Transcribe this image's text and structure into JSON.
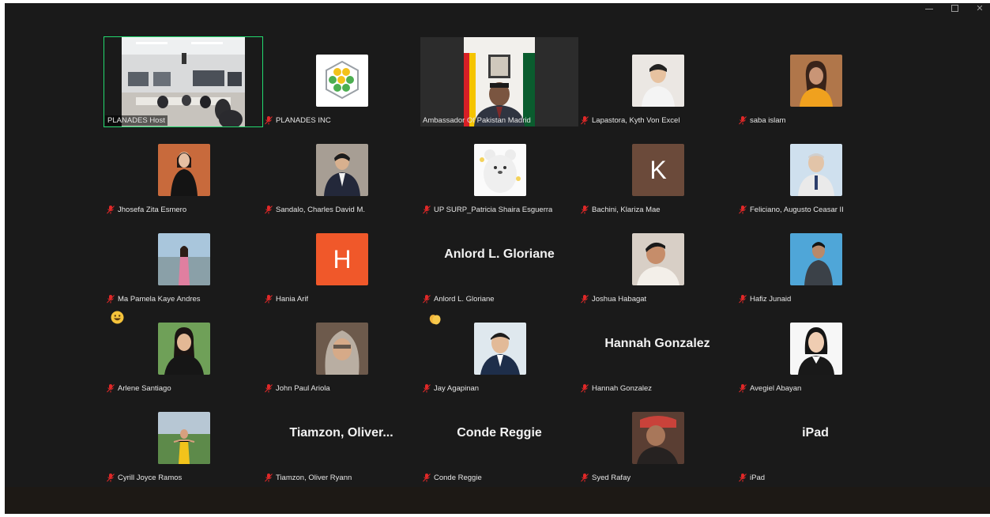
{
  "window": {
    "controls": [
      "minimize",
      "restore",
      "close"
    ]
  },
  "colors": {
    "active_speaker_border": "#23d96f",
    "muted_mic": "#e02828",
    "background": "#1a1a1a"
  },
  "participants": [
    {
      "name": "PLANADES Host",
      "muted": false,
      "video": "classroom",
      "active": true
    },
    {
      "name": "PLANADES INC",
      "muted": true,
      "avatar": "honeycomb-logo"
    },
    {
      "name": "Ambassador Of Pakistan Madrid",
      "muted": false,
      "video": "office-flags"
    },
    {
      "name": "Lapastora, Kyth Von Excel",
      "muted": true,
      "avatar": "photo"
    },
    {
      "name": "saba islam",
      "muted": true,
      "avatar": "photo"
    },
    {
      "name": "Jhosefa Zita Esmero",
      "muted": true,
      "avatar": "photo"
    },
    {
      "name": "Sandalo, Charles David M.",
      "muted": true,
      "avatar": "photo"
    },
    {
      "name": "UP SURP_Patricia Shaira Esguerra",
      "muted": true,
      "avatar": "bear"
    },
    {
      "name": "Bachini, Klariza Mae",
      "muted": true,
      "avatar_letter": "K",
      "avatar_color": "#6b4a3a"
    },
    {
      "name": "Feliciano, Augusto Ceasar II",
      "muted": true,
      "avatar": "photo"
    },
    {
      "name": "Ma Pamela Kaye Andres",
      "muted": true,
      "avatar": "photo"
    },
    {
      "name": "Hania Arif",
      "muted": true,
      "avatar_letter": "H",
      "avatar_color": "#f0582a"
    },
    {
      "name": "Anlord L. Gloriane",
      "muted": true,
      "display_name": "Anlord L. Gloriane"
    },
    {
      "name": "Joshua Habagat",
      "muted": true,
      "avatar": "photo"
    },
    {
      "name": "Hafiz Junaid",
      "muted": true,
      "avatar": "photo"
    },
    {
      "name": "Arlene Santiago",
      "muted": true,
      "avatar": "photo",
      "reaction": "grinning-emoji"
    },
    {
      "name": "John Paul Ariola",
      "muted": true,
      "avatar": "photo"
    },
    {
      "name": "Jay Agapinan",
      "muted": true,
      "avatar": "photo",
      "reaction": "clap-emoji"
    },
    {
      "name": "Hannah Gonzalez",
      "muted": true,
      "display_name": "Hannah Gonzalez"
    },
    {
      "name": "Avegiel Abayan",
      "muted": true,
      "avatar": "photo"
    },
    {
      "name": "Cyrill Joyce Ramos",
      "muted": true,
      "avatar": "photo"
    },
    {
      "name": "Tiamzon, Oliver Ryann",
      "muted": true,
      "display_name": "Tiamzon,  Oliver..."
    },
    {
      "name": "Conde Reggie",
      "muted": true,
      "display_name": "Conde Reggie"
    },
    {
      "name": "Syed Rafay",
      "muted": true,
      "avatar": "photo"
    },
    {
      "name": "iPad",
      "muted": true,
      "display_name": "iPad"
    }
  ]
}
